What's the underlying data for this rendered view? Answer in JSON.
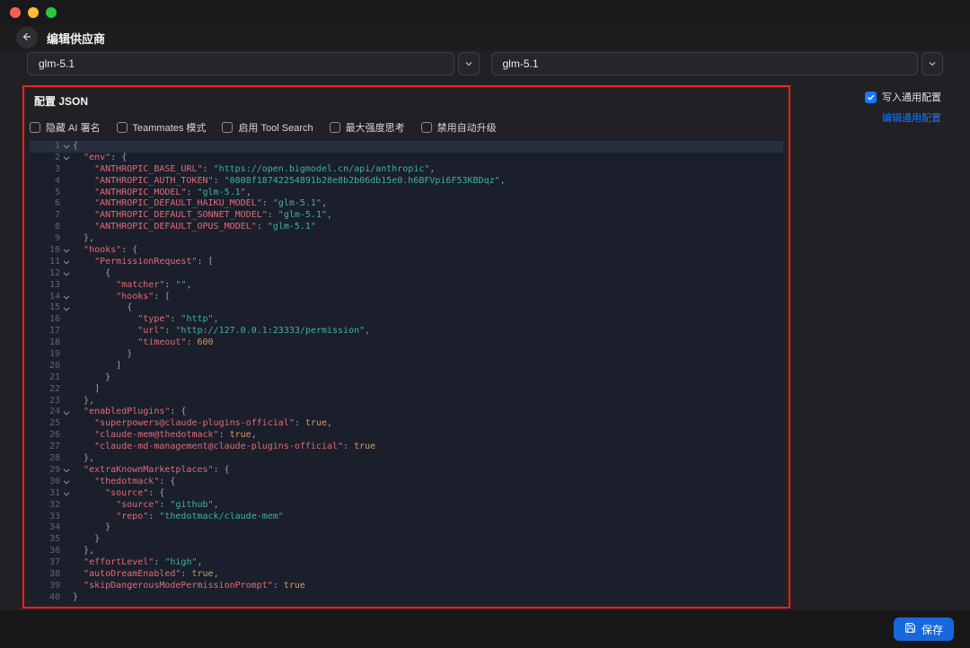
{
  "colors": {
    "accent": "#1677ff",
    "save-btn": "#1668dc",
    "annotation": "#ff1e1e",
    "editor-bg": "#1a1f2b",
    "tk-key": "#e06c75",
    "tk-string": "#3fb39d",
    "tk-number": "#d19a66",
    "tk-bool": "#d19a66",
    "tk-punct": "#9aa4b2",
    "line-number": "#5e6773"
  },
  "header": {
    "title": "编辑供应商"
  },
  "selects": [
    {
      "value": "glm-5.1"
    },
    {
      "value": "glm-5.1"
    }
  ],
  "config_section": {
    "title": "配置 JSON",
    "checkboxes": [
      {
        "name": "hide-ai-signature",
        "label": "隐藏 AI 署名",
        "checked": false
      },
      {
        "name": "teammates-mode",
        "label": "Teammates 模式",
        "checked": false
      },
      {
        "name": "enable-tool-search",
        "label": "启用 Tool Search",
        "checked": false
      },
      {
        "name": "max-strength-thinking",
        "label": "最大强度思考",
        "checked": false
      },
      {
        "name": "disable-auto-upgrade",
        "label": "禁用自动升级",
        "checked": false
      }
    ]
  },
  "right_panel": {
    "write_common_config_label": "写入通用配置",
    "write_common_config_checked": true,
    "edit_common_config_label": "编辑通用配置"
  },
  "footer": {
    "save_label": "保存"
  },
  "editor": {
    "lines": [
      {
        "fold": true,
        "t": [
          [
            "p",
            "{"
          ]
        ]
      },
      {
        "fold": true,
        "t": [
          [
            "p",
            "  "
          ],
          [
            "k",
            "\"env\""
          ],
          [
            "p",
            ": {"
          ]
        ]
      },
      {
        "t": [
          [
            "p",
            "    "
          ],
          [
            "k",
            "\"ANTHROPIC_BASE_URL\""
          ],
          [
            "p",
            ": "
          ],
          [
            "s",
            "\"https://open.bigmodel.cn/api/anthropic\""
          ],
          [
            "p",
            ","
          ]
        ]
      },
      {
        "t": [
          [
            "p",
            "    "
          ],
          [
            "k",
            "\"ANTHROPIC_AUTH_TOKEN\""
          ],
          [
            "p",
            ": "
          ],
          [
            "s",
            "\"0808f18742254891b28e8b2b06db15e0.h6BFVpi6F53KBDqz\""
          ],
          [
            "p",
            ","
          ]
        ]
      },
      {
        "t": [
          [
            "p",
            "    "
          ],
          [
            "k",
            "\"ANTHROPIC_MODEL\""
          ],
          [
            "p",
            ": "
          ],
          [
            "s",
            "\"glm-5.1\""
          ],
          [
            "p",
            ","
          ]
        ]
      },
      {
        "t": [
          [
            "p",
            "    "
          ],
          [
            "k",
            "\"ANTHROPIC_DEFAULT_HAIKU_MODEL\""
          ],
          [
            "p",
            ": "
          ],
          [
            "s",
            "\"glm-5.1\""
          ],
          [
            "p",
            ","
          ]
        ]
      },
      {
        "t": [
          [
            "p",
            "    "
          ],
          [
            "k",
            "\"ANTHROPIC_DEFAULT_SONNET_MODEL\""
          ],
          [
            "p",
            ": "
          ],
          [
            "s",
            "\"glm-5.1\""
          ],
          [
            "p",
            ","
          ]
        ]
      },
      {
        "t": [
          [
            "p",
            "    "
          ],
          [
            "k",
            "\"ANTHROPIC_DEFAULT_OPUS_MODEL\""
          ],
          [
            "p",
            ": "
          ],
          [
            "s",
            "\"glm-5.1\""
          ]
        ]
      },
      {
        "t": [
          [
            "p",
            "  },"
          ]
        ]
      },
      {
        "fold": true,
        "t": [
          [
            "p",
            "  "
          ],
          [
            "k",
            "\"hooks\""
          ],
          [
            "p",
            ": {"
          ]
        ]
      },
      {
        "fold": true,
        "t": [
          [
            "p",
            "    "
          ],
          [
            "k",
            "\"PermissionRequest\""
          ],
          [
            "p",
            ": ["
          ]
        ]
      },
      {
        "fold": true,
        "t": [
          [
            "p",
            "      {"
          ]
        ]
      },
      {
        "t": [
          [
            "p",
            "        "
          ],
          [
            "k",
            "\"matcher\""
          ],
          [
            "p",
            ": "
          ],
          [
            "s",
            "\"\""
          ],
          [
            "p",
            ","
          ]
        ]
      },
      {
        "fold": true,
        "t": [
          [
            "p",
            "        "
          ],
          [
            "k",
            "\"hooks\""
          ],
          [
            "p",
            ": ["
          ]
        ]
      },
      {
        "fold": true,
        "t": [
          [
            "p",
            "          {"
          ]
        ]
      },
      {
        "t": [
          [
            "p",
            "            "
          ],
          [
            "k",
            "\"type\""
          ],
          [
            "p",
            ": "
          ],
          [
            "s",
            "\"http\""
          ],
          [
            "p",
            ","
          ]
        ]
      },
      {
        "t": [
          [
            "p",
            "            "
          ],
          [
            "k",
            "\"url\""
          ],
          [
            "p",
            ": "
          ],
          [
            "s",
            "\"http://127.0.0.1:23333/permission\""
          ],
          [
            "p",
            ","
          ]
        ]
      },
      {
        "t": [
          [
            "p",
            "            "
          ],
          [
            "k",
            "\"timeout\""
          ],
          [
            "p",
            ": "
          ],
          [
            "n",
            "600"
          ]
        ]
      },
      {
        "t": [
          [
            "p",
            "          }"
          ]
        ]
      },
      {
        "t": [
          [
            "p",
            "        ]"
          ]
        ]
      },
      {
        "t": [
          [
            "p",
            "      }"
          ]
        ]
      },
      {
        "t": [
          [
            "p",
            "    ]"
          ]
        ]
      },
      {
        "t": [
          [
            "p",
            "  },"
          ]
        ]
      },
      {
        "fold": true,
        "t": [
          [
            "p",
            "  "
          ],
          [
            "k",
            "\"enabledPlugins\""
          ],
          [
            "p",
            ": {"
          ]
        ]
      },
      {
        "t": [
          [
            "p",
            "    "
          ],
          [
            "k",
            "\"superpowers@claude-plugins-official\""
          ],
          [
            "p",
            ": "
          ],
          [
            "b",
            "true"
          ],
          [
            "p",
            ","
          ]
        ]
      },
      {
        "t": [
          [
            "p",
            "    "
          ],
          [
            "k",
            "\"claude-mem@thedotmack\""
          ],
          [
            "p",
            ": "
          ],
          [
            "b",
            "true"
          ],
          [
            "p",
            ","
          ]
        ]
      },
      {
        "t": [
          [
            "p",
            "    "
          ],
          [
            "k",
            "\"claude-md-management@claude-plugins-official\""
          ],
          [
            "p",
            ": "
          ],
          [
            "b",
            "true"
          ]
        ]
      },
      {
        "t": [
          [
            "p",
            "  },"
          ]
        ]
      },
      {
        "fold": true,
        "t": [
          [
            "p",
            "  "
          ],
          [
            "k",
            "\"extraKnownMarketplaces\""
          ],
          [
            "p",
            ": {"
          ]
        ]
      },
      {
        "fold": true,
        "t": [
          [
            "p",
            "    "
          ],
          [
            "k",
            "\"thedotmack\""
          ],
          [
            "p",
            ": {"
          ]
        ]
      },
      {
        "fold": true,
        "t": [
          [
            "p",
            "      "
          ],
          [
            "k",
            "\"source\""
          ],
          [
            "p",
            ": {"
          ]
        ]
      },
      {
        "t": [
          [
            "p",
            "        "
          ],
          [
            "k",
            "\"source\""
          ],
          [
            "p",
            ": "
          ],
          [
            "s",
            "\"github\""
          ],
          [
            "p",
            ","
          ]
        ]
      },
      {
        "t": [
          [
            "p",
            "        "
          ],
          [
            "k",
            "\"repo\""
          ],
          [
            "p",
            ": "
          ],
          [
            "s",
            "\"thedotmack/claude-mem\""
          ]
        ]
      },
      {
        "t": [
          [
            "p",
            "      }"
          ]
        ]
      },
      {
        "t": [
          [
            "p",
            "    }"
          ]
        ]
      },
      {
        "t": [
          [
            "p",
            "  },"
          ]
        ]
      },
      {
        "t": [
          [
            "p",
            "  "
          ],
          [
            "k",
            "\"effortLevel\""
          ],
          [
            "p",
            ": "
          ],
          [
            "s",
            "\"high\""
          ],
          [
            "p",
            ","
          ]
        ]
      },
      {
        "t": [
          [
            "p",
            "  "
          ],
          [
            "k",
            "\"autoDreamEnabled\""
          ],
          [
            "p",
            ": "
          ],
          [
            "b",
            "true"
          ],
          [
            "p",
            ","
          ]
        ]
      },
      {
        "t": [
          [
            "p",
            "  "
          ],
          [
            "k",
            "\"skipDangerousModePermissionPrompt\""
          ],
          [
            "p",
            ": "
          ],
          [
            "b",
            "true"
          ]
        ]
      },
      {
        "t": [
          [
            "p",
            "}"
          ]
        ]
      }
    ]
  }
}
